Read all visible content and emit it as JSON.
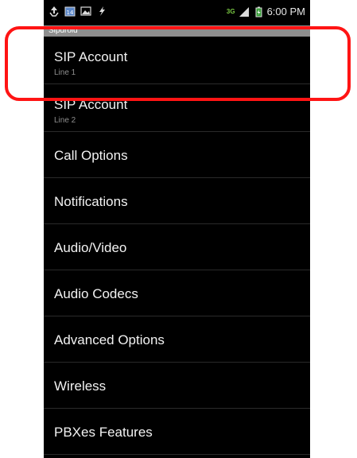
{
  "status_bar": {
    "icons_left": [
      "recycle-icon",
      "calendar-icon",
      "image-icon",
      "usb-icon"
    ],
    "calendar_day": "14",
    "network": "3G",
    "time": "6:00 PM"
  },
  "app": {
    "title": "Sipdroid"
  },
  "menu": {
    "items": [
      {
        "label": "SIP Account",
        "sub": "Line 1"
      },
      {
        "label": "SIP Account",
        "sub": "Line 2"
      },
      {
        "label": "Call Options"
      },
      {
        "label": "Notifications"
      },
      {
        "label": "Audio/Video"
      },
      {
        "label": "Audio Codecs"
      },
      {
        "label": "Advanced Options"
      },
      {
        "label": "Wireless"
      },
      {
        "label": "PBXes Features"
      }
    ]
  },
  "colors": {
    "background": "#000000",
    "title_bar": "#8e8e8e",
    "highlight": "#ff1414",
    "subtext": "#8f8f8f"
  }
}
